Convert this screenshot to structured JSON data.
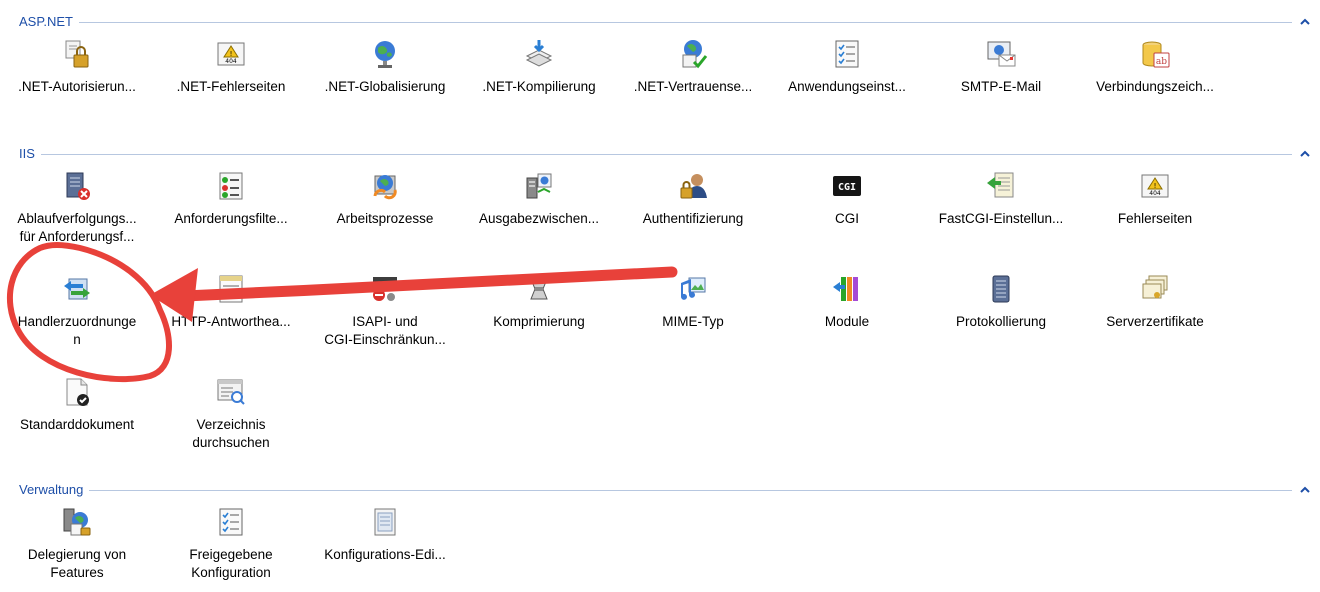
{
  "sections": [
    {
      "title": "ASP.NET",
      "items": [
        {
          "label": ".NET-Autorisierun...",
          "icon": "lock-document-icon"
        },
        {
          "label": ".NET-Fehlerseiten",
          "icon": "error-404-icon"
        },
        {
          "label": ".NET-Globalisierung",
          "icon": "globe-icon"
        },
        {
          "label": ".NET-Kompilierung",
          "icon": "compile-stack-icon"
        },
        {
          "label": ".NET-Vertrauense...",
          "icon": "trust-check-icon"
        },
        {
          "label": "Anwendungseinst...",
          "icon": "checklist-icon"
        },
        {
          "label": "SMTP-E-Mail",
          "icon": "email-icon"
        },
        {
          "label": "Verbindungszeich...",
          "icon": "database-icon"
        }
      ]
    },
    {
      "title": "IIS",
      "items": [
        {
          "label": "Ablaufverfolgungs...\nfür Anforderungsf...",
          "icon": "failed-request-tracing-icon"
        },
        {
          "label": "Anforderungsfilte...",
          "icon": "request-filter-icon"
        },
        {
          "label": "Arbeitsprozesse",
          "icon": "worker-process-icon"
        },
        {
          "label": "Ausgabezwischen...",
          "icon": "output-cache-icon"
        },
        {
          "label": "Authentifizierung",
          "icon": "authentication-icon"
        },
        {
          "label": "CGI",
          "icon": "cgi-icon"
        },
        {
          "label": "FastCGI-Einstellun...",
          "icon": "fastcgi-icon"
        },
        {
          "label": "Fehlerseiten",
          "icon": "error-404-icon"
        },
        {
          "label": "Handlerzuordnunge\nn",
          "icon": "handler-mappings-icon"
        },
        {
          "label": "HTTP-Antworthea...",
          "icon": "http-headers-icon"
        },
        {
          "label": "ISAPI- und\nCGI-Einschränkun...",
          "icon": "isapi-restrictions-icon"
        },
        {
          "label": "Komprimierung",
          "icon": "compression-icon"
        },
        {
          "label": "MIME-Typ",
          "icon": "mime-type-icon"
        },
        {
          "label": "Module",
          "icon": "modules-icon"
        },
        {
          "label": "Protokollierung",
          "icon": "logging-icon"
        },
        {
          "label": "Serverzertifikate",
          "icon": "certificates-icon"
        },
        {
          "label": "Standarddokument",
          "icon": "default-document-icon"
        },
        {
          "label": "Verzeichnis\ndurchsuchen",
          "icon": "directory-browsing-icon"
        }
      ]
    },
    {
      "title": "Verwaltung",
      "items": [
        {
          "label": "Delegierung von\nFeatures",
          "icon": "feature-delegation-icon"
        },
        {
          "label": "Freigegebene\nKonfiguration",
          "icon": "shared-configuration-icon"
        },
        {
          "label": "Konfigurations-Edi...",
          "icon": "configuration-editor-icon"
        }
      ]
    }
  ],
  "colors": {
    "section_title": "#1e4fa8",
    "annotation": "#e8413a"
  }
}
